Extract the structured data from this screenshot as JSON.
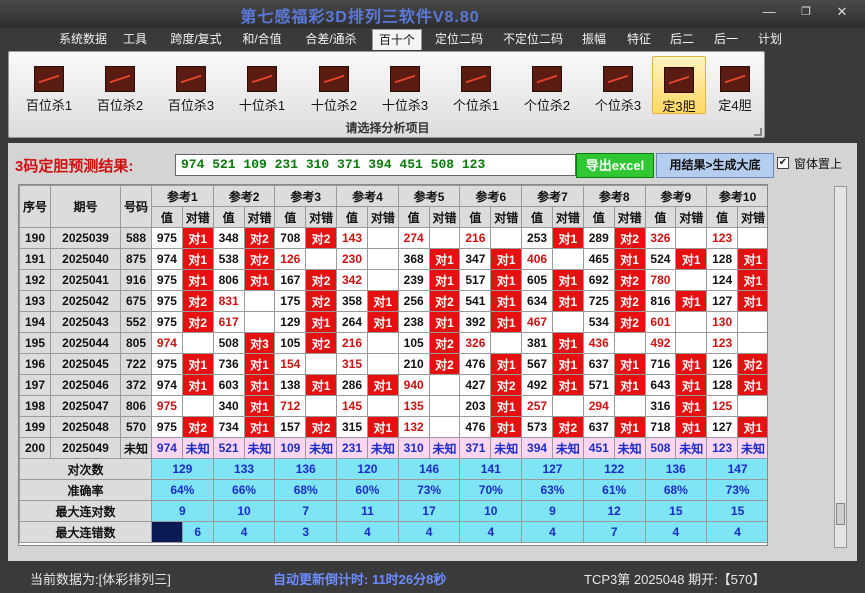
{
  "window": {
    "title": "第七感福彩3D排列三软件V8.80"
  },
  "menu": [
    "系统数据",
    "工具",
    "跨度/复式",
    "和/合值",
    "合差/通杀",
    "百十个",
    "定位二码",
    "不定位二码",
    "振幅",
    "特征",
    "后二",
    "后一",
    "计划"
  ],
  "menu_active": 5,
  "ribbon": {
    "tools": [
      "百位杀1",
      "百位杀2",
      "百位杀3",
      "十位杀1",
      "十位杀2",
      "十位杀3",
      "个位杀1",
      "个位杀2",
      "个位杀3",
      "定3胆",
      "定4胆"
    ],
    "selected": 9,
    "caption": "请选择分析项目",
    "icon": "line-chart-icon"
  },
  "result": {
    "label": "3码定胆预测结果:",
    "value": "974 521 109 231 310 371 394 451 508 123",
    "export_label": "导出excel",
    "generate_label": "用结果>生成大底",
    "ontop_label": "窗体置上",
    "ontop_checked": true
  },
  "table": {
    "col_seq": "序号",
    "col_issue": "期号",
    "col_code": "号码",
    "refs": [
      "参考1",
      "参考2",
      "参考3",
      "参考4",
      "参考5",
      "参考6",
      "参考7",
      "参考8",
      "参考9",
      "参考10"
    ],
    "sub_val": "值",
    "sub_hit": "对错",
    "rows": [
      {
        "seq": "190",
        "issue": "2025039",
        "code": "588",
        "cells": [
          [
            "975",
            "对1"
          ],
          [
            "348",
            "对2"
          ],
          [
            "708",
            "对2"
          ],
          [
            "143",
            ""
          ],
          [
            "274",
            ""
          ],
          [
            "216",
            ""
          ],
          [
            "253",
            "对1"
          ],
          [
            "289",
            "对2"
          ],
          [
            "326",
            ""
          ],
          [
            "123",
            ""
          ]
        ]
      },
      {
        "seq": "191",
        "issue": "2025040",
        "code": "875",
        "cells": [
          [
            "974",
            "对1"
          ],
          [
            "538",
            "对2"
          ],
          [
            "126",
            ""
          ],
          [
            "230",
            ""
          ],
          [
            "368",
            "对1"
          ],
          [
            "347",
            "对1"
          ],
          [
            "406",
            ""
          ],
          [
            "465",
            "对1"
          ],
          [
            "524",
            "对1"
          ],
          [
            "128",
            "对1"
          ]
        ]
      },
      {
        "seq": "192",
        "issue": "2025041",
        "code": "916",
        "cells": [
          [
            "975",
            "对1"
          ],
          [
            "806",
            "对1"
          ],
          [
            "167",
            "对2"
          ],
          [
            "342",
            ""
          ],
          [
            "239",
            "对1"
          ],
          [
            "517",
            "对1"
          ],
          [
            "605",
            "对1"
          ],
          [
            "692",
            "对2"
          ],
          [
            "780",
            ""
          ],
          [
            "124",
            "对1"
          ]
        ]
      },
      {
        "seq": "193",
        "issue": "2025042",
        "code": "675",
        "cells": [
          [
            "975",
            "对2"
          ],
          [
            "831",
            ""
          ],
          [
            "175",
            "对2"
          ],
          [
            "358",
            "对1"
          ],
          [
            "256",
            "对2"
          ],
          [
            "541",
            "对1"
          ],
          [
            "634",
            "对1"
          ],
          [
            "725",
            "对2"
          ],
          [
            "816",
            "对1"
          ],
          [
            "127",
            "对1"
          ]
        ]
      },
      {
        "seq": "194",
        "issue": "2025043",
        "code": "552",
        "cells": [
          [
            "975",
            "对2"
          ],
          [
            "617",
            ""
          ],
          [
            "129",
            "对1"
          ],
          [
            "264",
            "对1"
          ],
          [
            "238",
            "对1"
          ],
          [
            "392",
            "对1"
          ],
          [
            "467",
            ""
          ],
          [
            "534",
            "对2"
          ],
          [
            "601",
            ""
          ],
          [
            "130",
            ""
          ]
        ]
      },
      {
        "seq": "195",
        "issue": "2025044",
        "code": "805",
        "cells": [
          [
            "974",
            ""
          ],
          [
            "508",
            "对3"
          ],
          [
            "105",
            "对2"
          ],
          [
            "216",
            ""
          ],
          [
            "105",
            "对2"
          ],
          [
            "326",
            ""
          ],
          [
            "381",
            "对1"
          ],
          [
            "436",
            ""
          ],
          [
            "492",
            ""
          ],
          [
            "123",
            ""
          ]
        ]
      },
      {
        "seq": "196",
        "issue": "2025045",
        "code": "722",
        "cells": [
          [
            "975",
            "对1"
          ],
          [
            "736",
            "对1"
          ],
          [
            "154",
            ""
          ],
          [
            "315",
            ""
          ],
          [
            "210",
            "对2"
          ],
          [
            "476",
            "对1"
          ],
          [
            "567",
            "对1"
          ],
          [
            "637",
            "对1"
          ],
          [
            "716",
            "对1"
          ],
          [
            "126",
            "对2"
          ]
        ]
      },
      {
        "seq": "197",
        "issue": "2025046",
        "code": "372",
        "cells": [
          [
            "974",
            "对1"
          ],
          [
            "603",
            "对1"
          ],
          [
            "138",
            "对1"
          ],
          [
            "286",
            "对1"
          ],
          [
            "940",
            ""
          ],
          [
            "427",
            "对2"
          ],
          [
            "492",
            "对1"
          ],
          [
            "571",
            "对1"
          ],
          [
            "643",
            "对1"
          ],
          [
            "128",
            "对1"
          ]
        ]
      },
      {
        "seq": "198",
        "issue": "2025047",
        "code": "806",
        "cells": [
          [
            "975",
            ""
          ],
          [
            "340",
            "对1"
          ],
          [
            "712",
            ""
          ],
          [
            "145",
            ""
          ],
          [
            "135",
            ""
          ],
          [
            "203",
            "对1"
          ],
          [
            "257",
            ""
          ],
          [
            "294",
            ""
          ],
          [
            "316",
            "对1"
          ],
          [
            "125",
            ""
          ]
        ]
      },
      {
        "seq": "199",
        "issue": "2025048",
        "code": "570",
        "cells": [
          [
            "975",
            "对2"
          ],
          [
            "734",
            "对1"
          ],
          [
            "157",
            "对2"
          ],
          [
            "315",
            "对1"
          ],
          [
            "132",
            ""
          ],
          [
            "476",
            "对1"
          ],
          [
            "573",
            "对2"
          ],
          [
            "637",
            "对1"
          ],
          [
            "718",
            "对1"
          ],
          [
            "127",
            "对1"
          ]
        ]
      }
    ],
    "forecast": {
      "seq": "200",
      "issue": "2025049",
      "code": "未知",
      "values": [
        "974",
        "521",
        "109",
        "231",
        "310",
        "371",
        "394",
        "451",
        "508",
        "123"
      ],
      "unknown": "未知"
    },
    "stats": [
      {
        "label": "对次数",
        "values": [
          "129",
          "133",
          "136",
          "120",
          "146",
          "141",
          "127",
          "122",
          "136",
          "147"
        ]
      },
      {
        "label": "准确率",
        "values": [
          "64%",
          "66%",
          "68%",
          "60%",
          "73%",
          "70%",
          "63%",
          "61%",
          "68%",
          "73%"
        ]
      },
      {
        "label": "最大连对数",
        "values": [
          "9",
          "10",
          "7",
          "11",
          "17",
          "10",
          "9",
          "12",
          "15",
          "15"
        ]
      },
      {
        "label": "最大连错数",
        "values": [
          "6",
          "4",
          "3",
          "4",
          "4",
          "4",
          "4",
          "7",
          "4",
          "4"
        ]
      }
    ]
  },
  "status": {
    "source": "当前数据为:[体彩排列三]",
    "countdown": "自动更新倒计时: 11时26分8秒",
    "draw": "TCP3第 2025048 期开:【570】"
  }
}
